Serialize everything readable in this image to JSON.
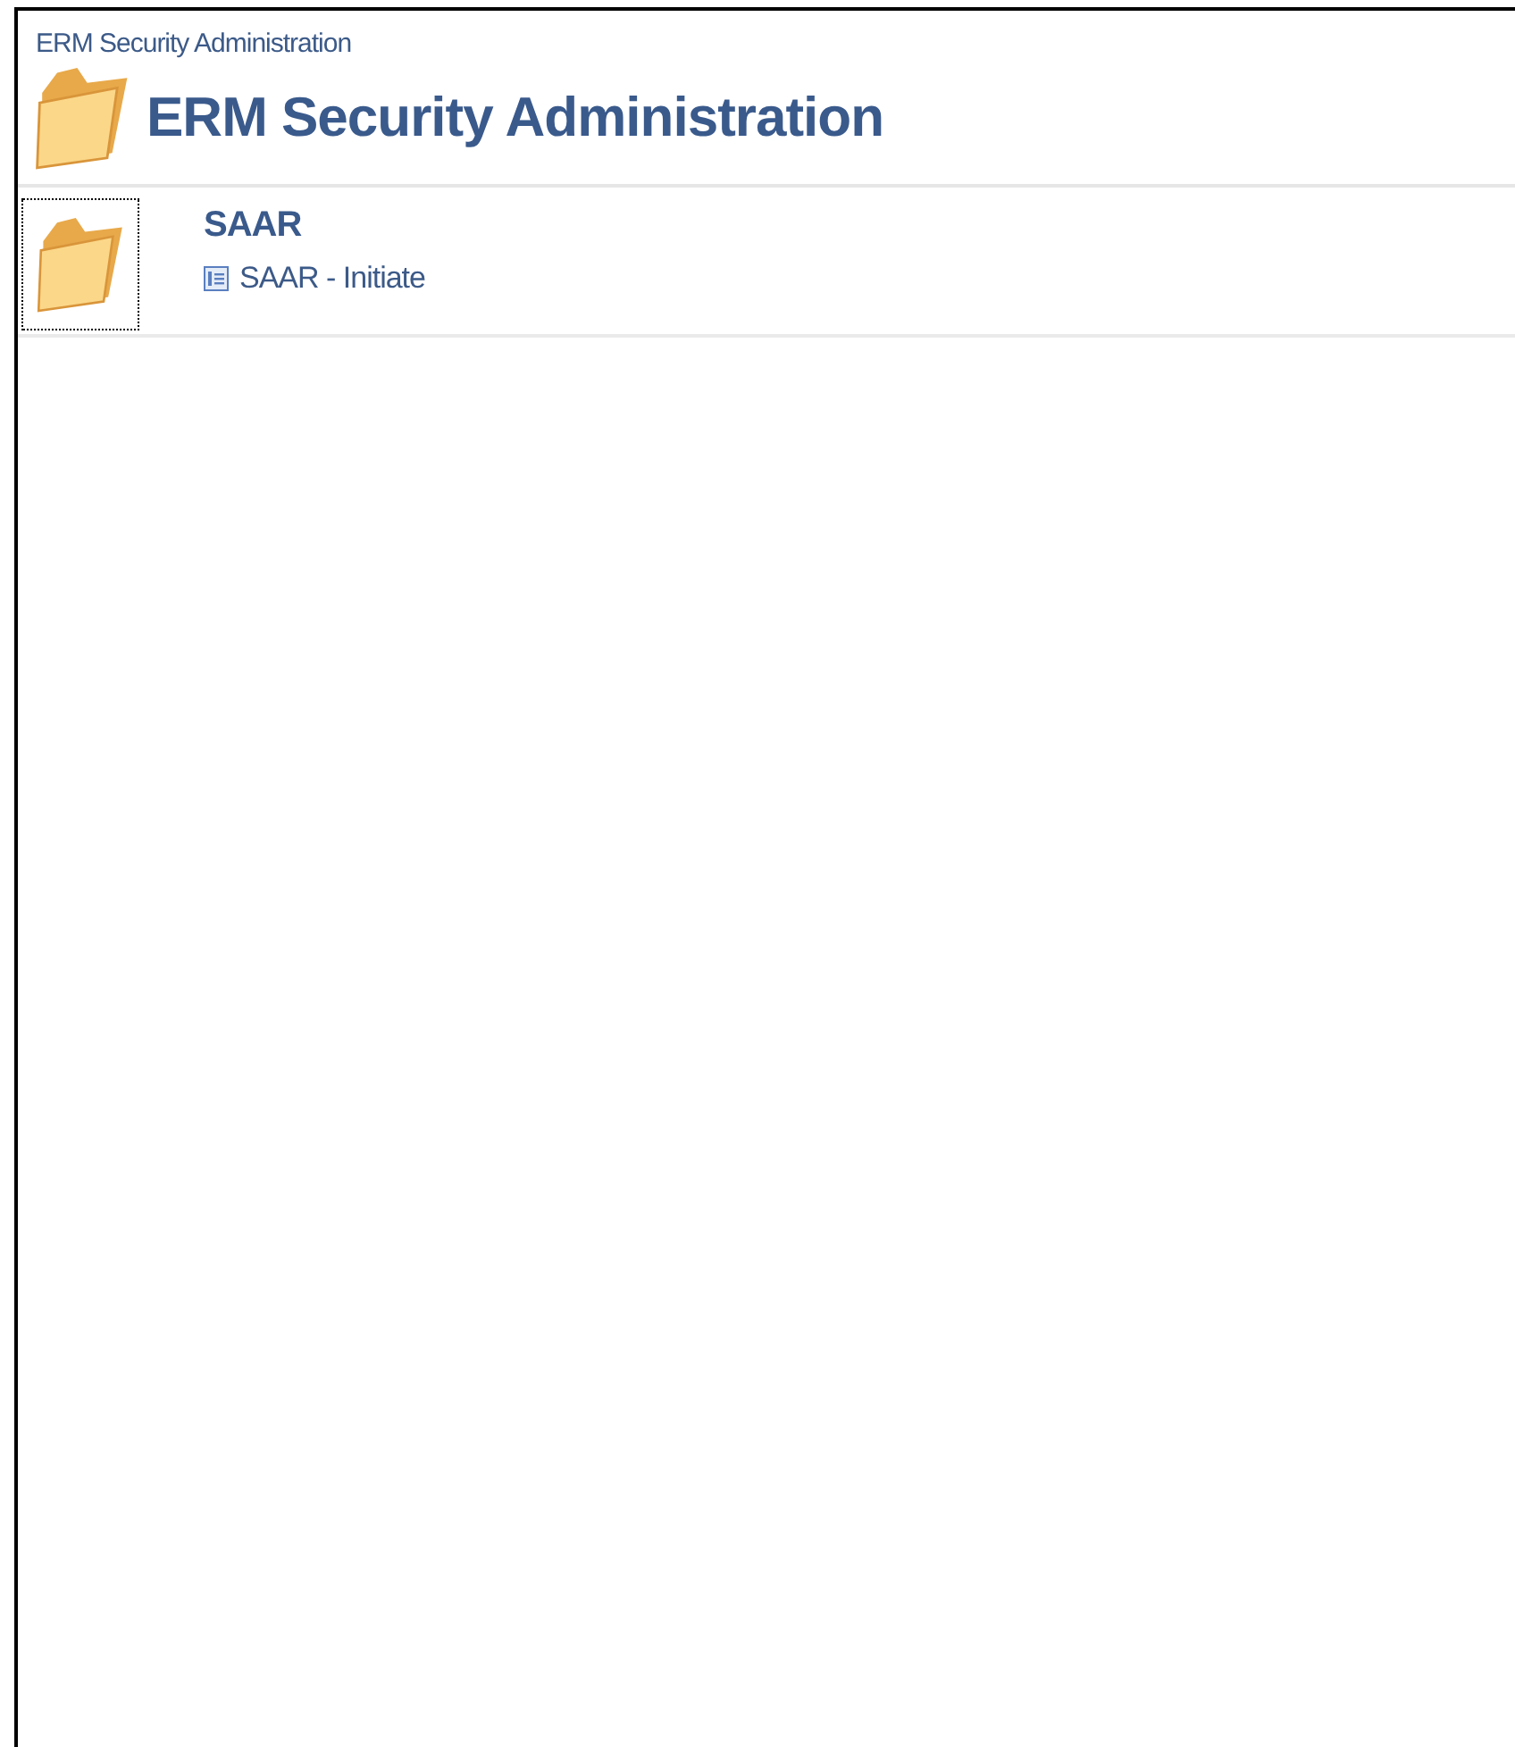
{
  "breadcrumb": "ERM Security Administration",
  "page_title": "ERM Security Administration",
  "folders": [
    {
      "title": "SAAR",
      "focused": true,
      "links": [
        {
          "label": "SAAR - Initiate"
        }
      ]
    }
  ]
}
